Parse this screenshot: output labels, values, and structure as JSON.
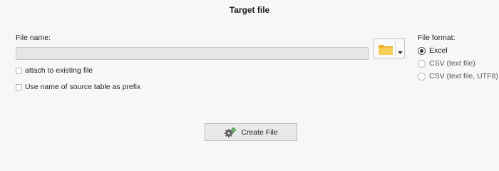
{
  "dialog": {
    "title": "Target file"
  },
  "file_name": {
    "label": "File name:",
    "value": "",
    "browse_icon": "folder-icon",
    "dropdown_icon": "chevron-down-icon"
  },
  "options": {
    "attach_label": "attach to existing file",
    "attach_checked": false,
    "prefix_label": "Use name of source table as prefix",
    "prefix_checked": false
  },
  "file_format": {
    "label": "File format:",
    "options": [
      {
        "label": "Excel",
        "selected": true
      },
      {
        "label": "CSV (text file)",
        "selected": false
      },
      {
        "label": "CSV (text file, UTF8)",
        "selected": false
      }
    ]
  },
  "actions": {
    "create_label": "Create File",
    "create_icon": "gears-icon"
  },
  "colors": {
    "background": "#f7f7f7",
    "folder": "#f4c74a",
    "gear_green": "#3f9a3f"
  }
}
